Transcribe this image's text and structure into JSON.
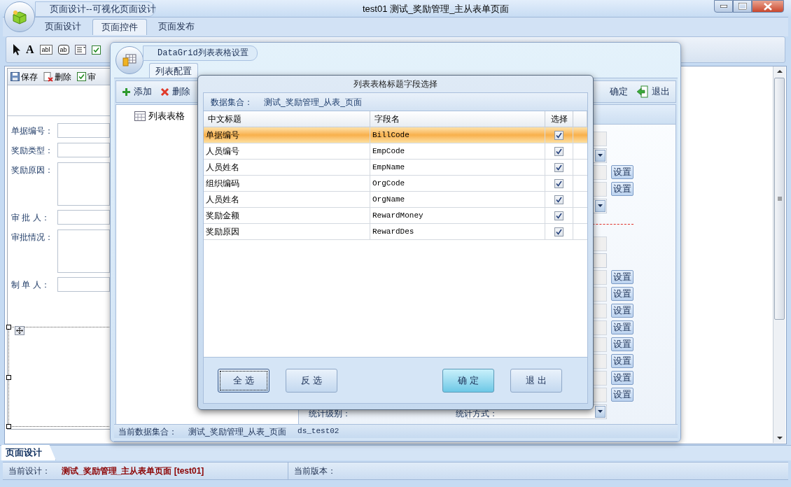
{
  "app": {
    "title_tab": "页面设计--可视化页面设计",
    "title": "test01  测试_奖励管理_主从表单页面"
  },
  "ribbon_tabs": [
    {
      "label": "页面设计",
      "selected": false
    },
    {
      "label": "页面控件",
      "selected": true
    },
    {
      "label": "页面发布",
      "selected": false
    }
  ],
  "tools": [
    {
      "kind": "pointer"
    },
    {
      "kind": "glyph",
      "glyph": "A"
    },
    {
      "kind": "boxed",
      "glyph": "abl"
    },
    {
      "kind": "rounded",
      "glyph": "ab"
    },
    {
      "kind": "list"
    },
    {
      "kind": "checkbox"
    }
  ],
  "design_form": {
    "toolbar": [
      {
        "kind": "save",
        "label": "保存"
      },
      {
        "kind": "delete",
        "label": "删除"
      },
      {
        "kind": "check",
        "label": "审"
      }
    ],
    "fields": [
      {
        "label": "单据编号：",
        "kind": "input"
      },
      {
        "label": "奖励类型：",
        "kind": "input"
      },
      {
        "label": "奖励原因：",
        "kind": "textarea"
      },
      {
        "label": "审 批 人：",
        "kind": "input"
      },
      {
        "label": "审批情况：",
        "kind": "textarea"
      },
      {
        "label": "制 单 人：",
        "kind": "input"
      }
    ]
  },
  "grid_settings": {
    "title": "DataGrid列表表格设置",
    "tabs": [
      {
        "label": "列表配置",
        "selected": true
      }
    ],
    "toolbar": [
      {
        "kind": "add",
        "label": "添加"
      },
      {
        "kind": "delete",
        "label": "删除"
      }
    ],
    "toolbar_right": [
      {
        "kind": "confirm",
        "label": "确定"
      },
      {
        "kind": "exit",
        "label": "退出"
      }
    ],
    "tree": [
      {
        "label": "列表表格"
      }
    ],
    "property_rows": [
      {
        "kind": "input"
      },
      {
        "kind": "dropdown"
      },
      {
        "kind": "input",
        "button": "设置"
      },
      {
        "kind": "input",
        "button": "设置"
      },
      {
        "kind": "dropdown"
      },
      {
        "kind": "separator"
      },
      {
        "kind": "input"
      },
      {
        "kind": "short"
      },
      {
        "kind": "input",
        "button": "设置"
      },
      {
        "kind": "input",
        "button": "设置"
      },
      {
        "kind": "input",
        "button": "设置"
      },
      {
        "kind": "input",
        "button": "设置"
      },
      {
        "kind": "input",
        "button": "设置"
      },
      {
        "kind": "input",
        "button": "设置"
      },
      {
        "kind": "input",
        "button": "设置"
      },
      {
        "kind": "input",
        "button": "设置"
      },
      {
        "kind": "dropdown"
      }
    ],
    "bottom_labels": [
      "统计级别：",
      "统计方式："
    ],
    "status": {
      "label": "当前数据集合：",
      "dataset": "测试_奖励管理_从表_页面",
      "id": "ds_test02"
    }
  },
  "dialog": {
    "title": "列表表格标题字段选择",
    "dataset_label": "数据集合：",
    "dataset": "测试_奖励管理_从表_页面",
    "columns": [
      "中文标题",
      "字段名",
      "选择"
    ],
    "rows": [
      {
        "title": "单据编号",
        "field": "BillCode",
        "checked": true,
        "selected": true
      },
      {
        "title": "人员编号",
        "field": "EmpCode",
        "checked": true,
        "selected": false
      },
      {
        "title": "人员姓名",
        "field": "EmpName",
        "checked": true,
        "selected": false
      },
      {
        "title": "组织编码",
        "field": "OrgCode",
        "checked": true,
        "selected": false
      },
      {
        "title": "人员姓名",
        "field": "OrgName",
        "checked": true,
        "selected": false
      },
      {
        "title": "奖励金额",
        "field": "RewardMoney",
        "checked": true,
        "selected": false
      },
      {
        "title": "奖励原因",
        "field": "RewardDes",
        "checked": true,
        "selected": false
      }
    ],
    "buttons": [
      {
        "label": "全 选",
        "kind": "focused"
      },
      {
        "label": "反 选",
        "kind": "normal"
      },
      {
        "label": "确 定",
        "kind": "default"
      },
      {
        "label": "退 出",
        "kind": "normal"
      }
    ]
  },
  "bottom_tab": {
    "label": "页面设计"
  },
  "status_bar": {
    "design_label": "当前设计：",
    "design": "测试_奖励管理_主从表单页面 [test01]",
    "version_label": "当前版本："
  }
}
